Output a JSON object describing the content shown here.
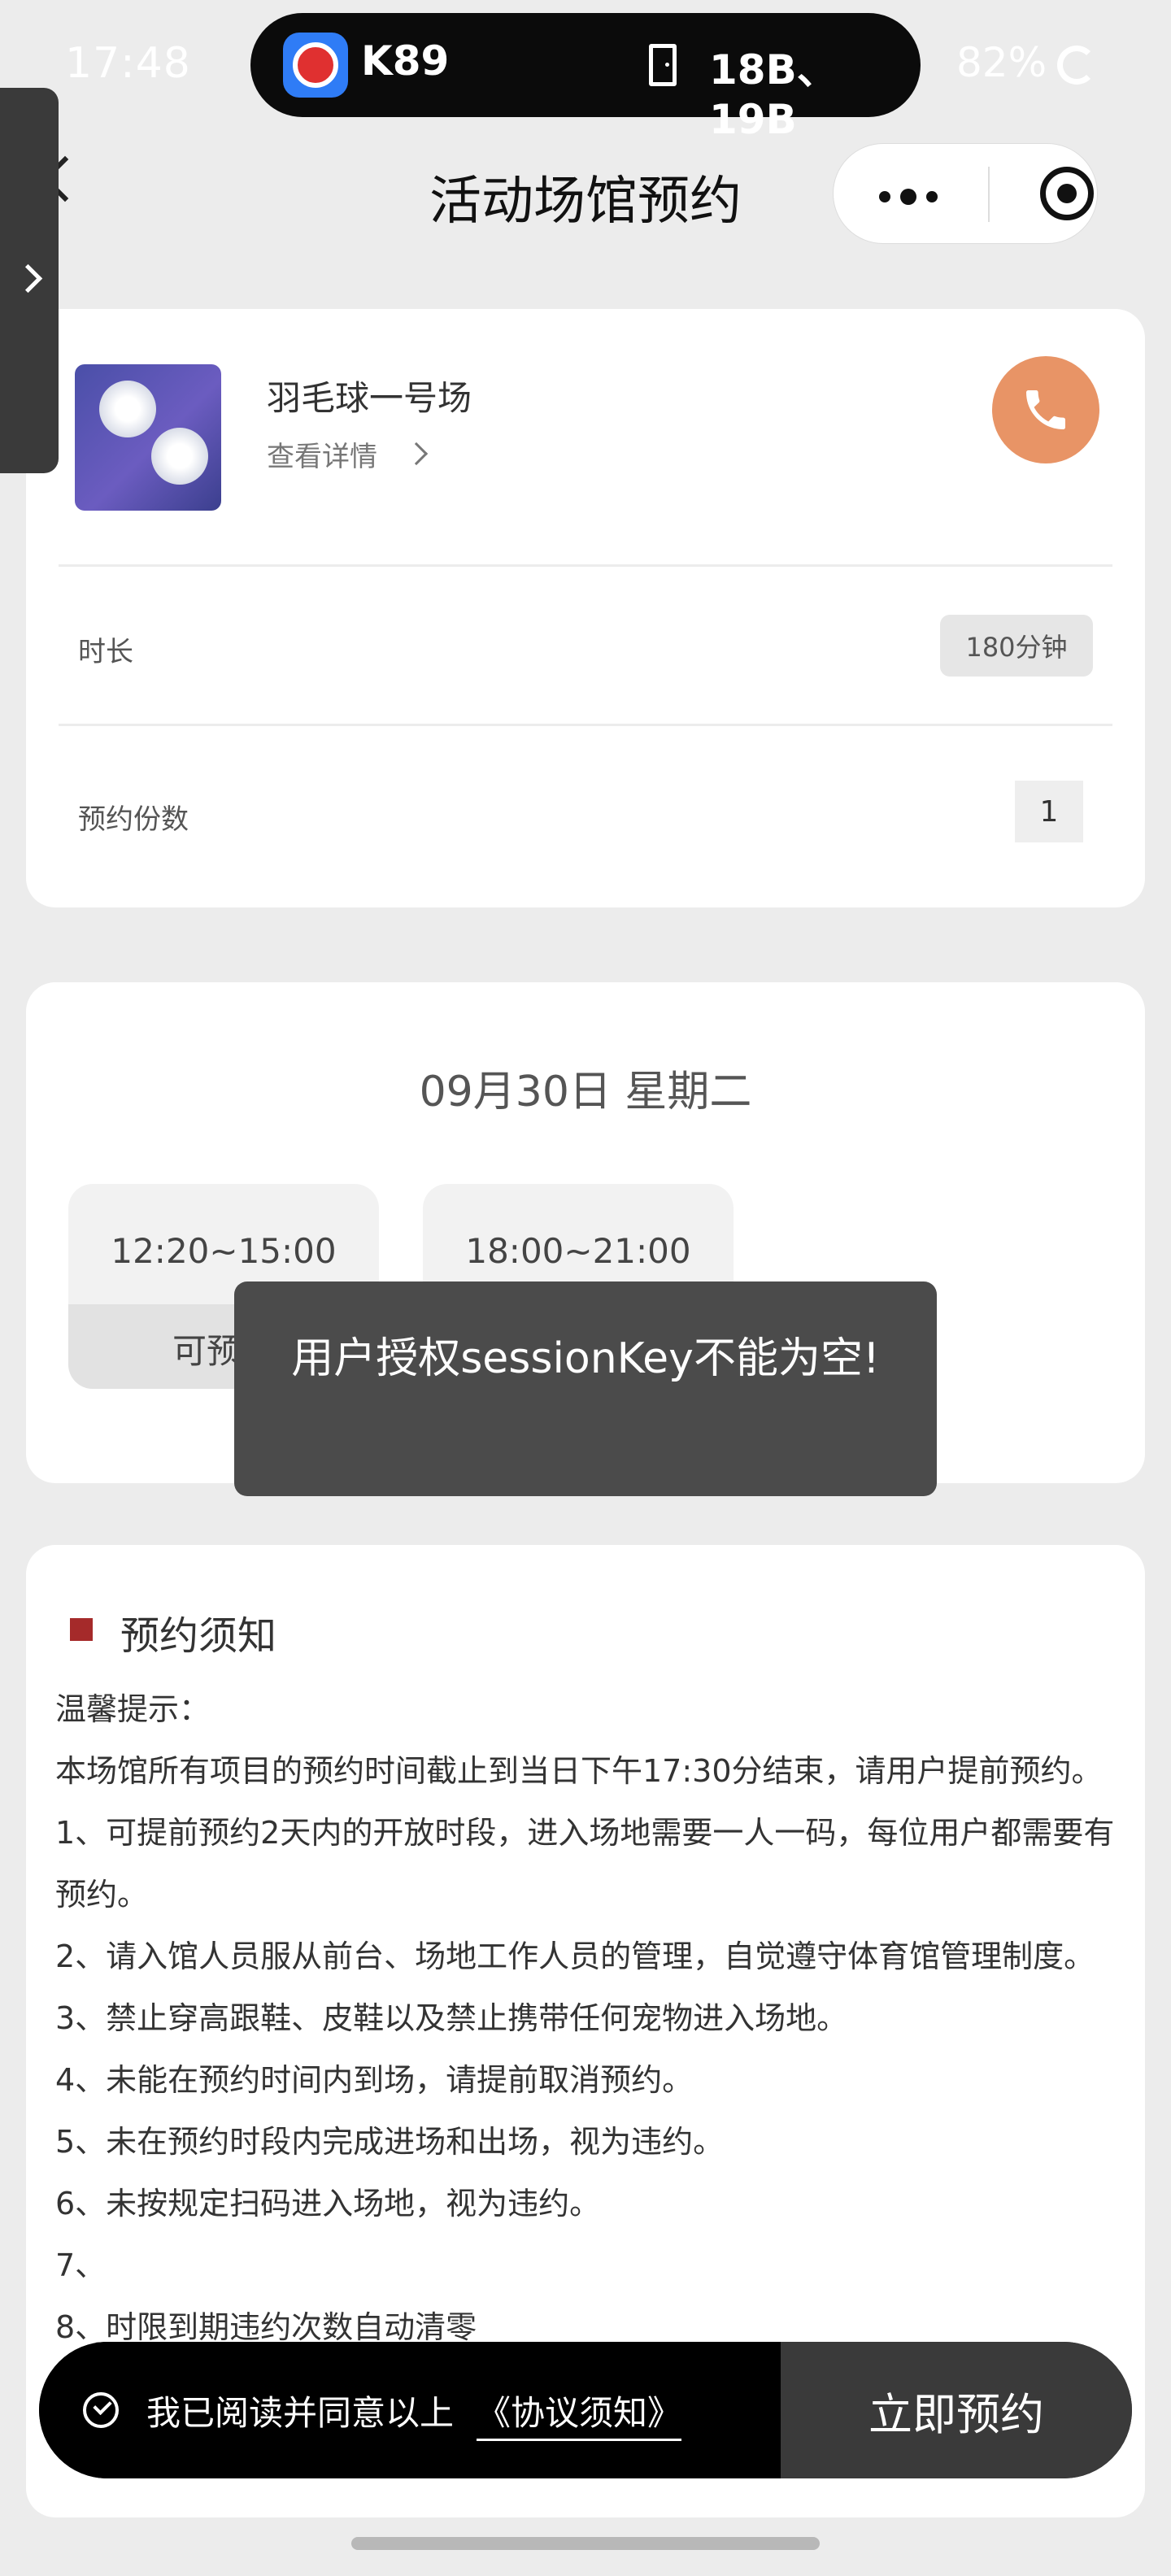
{
  "status_bar": {
    "time": "17:48",
    "train": "K89",
    "seats": "18B、19B",
    "battery": "82%"
  },
  "nav": {
    "title": "活动场馆预约"
  },
  "venue": {
    "name": "羽毛球一号场",
    "detail_link": "查看详情",
    "duration_label": "时长",
    "duration_value": "180分钟",
    "quantity_label": "预约份数",
    "quantity_value": "1"
  },
  "schedule": {
    "date": "09月30日 星期二",
    "slots": [
      {
        "time": "12:20~15:00",
        "status": "可预"
      },
      {
        "time": "18:00~21:00"
      }
    ]
  },
  "notice": {
    "title": "预约须知",
    "lines": [
      "温馨提示：",
      "本场馆所有项目的预约时间截止到当日下午17:30分结束，请用户提前预约。",
      "1、可提前预约2天内的开放时段，进入场地需要一人一码，每位用户都需要有预约。",
      "2、请入馆人员服从前台、场地工作人员的管理，自觉遵守体育馆管理制度。",
      "3、禁止穿高跟鞋、皮鞋以及禁止携带任何宠物进入场地。",
      "4、未能在预约时间内到场，请提前取消预约。",
      "5、未在预约时段内完成进场和出场，视为违约。",
      "6、未按规定扫码进入场地，视为违约。",
      "7、",
      "8、时限到期违约次数自动清零"
    ]
  },
  "toast": {
    "message": "用户授权sessionKey不能为空!"
  },
  "bottom_bar": {
    "agree_text": "我已阅读并同意以上",
    "agreement_link": "《协议须知》",
    "book_button": "立即预约"
  },
  "colors": {
    "phone_button": "#e89466",
    "notice_marker": "#a52a2a",
    "toast_bg": "#4b4b4b",
    "book_button_bg": "#3a3a3a"
  }
}
